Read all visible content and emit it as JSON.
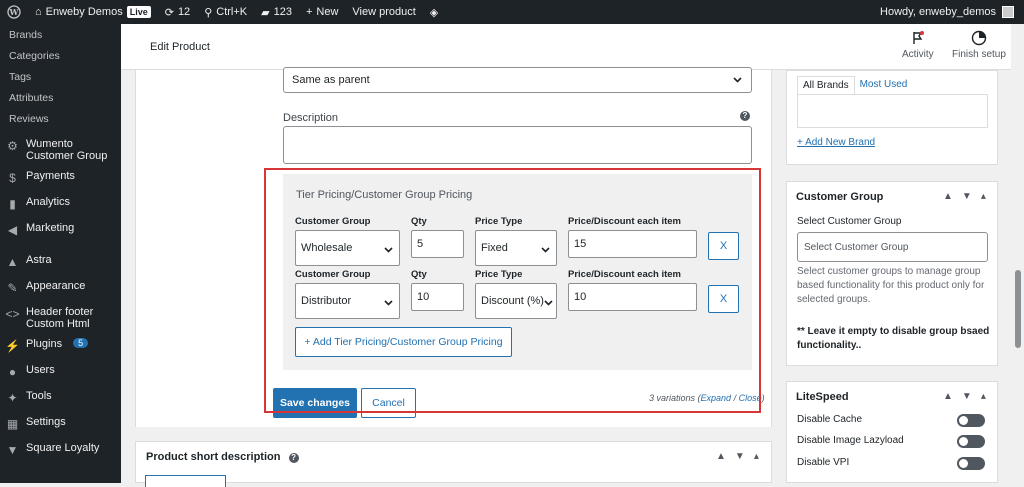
{
  "adminbar": {
    "site_name": "Enweby Demos",
    "live_label": "Live",
    "updates_count": "12",
    "shortcut": "Ctrl+K",
    "comments_count": "123",
    "new_label": "New",
    "view_product": "View product",
    "howdy": "Howdy, enweby_demos"
  },
  "sidebar": {
    "sub_items": [
      "Brands",
      "Categories",
      "Tags",
      "Attributes",
      "Reviews"
    ],
    "menu": {
      "wumento": "Wumento Customer Group",
      "payments": "Payments",
      "analytics": "Analytics",
      "marketing": "Marketing",
      "astra": "Astra",
      "appearance": "Appearance",
      "header_footer": "Header footer Custom Html",
      "plugins": "Plugins",
      "plugins_badge": "5",
      "users": "Users",
      "tools": "Tools",
      "settings": "Settings",
      "square": "Square Loyalty"
    }
  },
  "header": {
    "title": "Edit Product",
    "activity": "Activity",
    "finish_setup": "Finish setup"
  },
  "variation": {
    "shipping_select": "Same as parent",
    "description_label": "Description",
    "tier": {
      "title": "Tier Pricing/Customer Group Pricing",
      "col_group": "Customer Group",
      "col_qty": "Qty",
      "col_price_type": "Price Type",
      "col_discount": "Price/Discount each item",
      "rows": [
        {
          "group": "Wholesale",
          "qty": "5",
          "price_type": "Fixed",
          "discount": "15",
          "remove": "X"
        },
        {
          "group": "Distributor",
          "qty": "10",
          "price_type": "Discount (%)",
          "discount": "10",
          "remove": "X"
        }
      ],
      "add_label": "+ Add Tier Pricing/Customer Group Pricing"
    },
    "save_label": "Save changes",
    "cancel_label": "Cancel",
    "variations_count": "3 variations",
    "expand": "Expand",
    "close": "Close"
  },
  "short_description": {
    "title": "Product short description"
  },
  "brands_box": {
    "tab_all": "All Brands",
    "tab_used": "Most Used",
    "add_link": "+ Add New Brand"
  },
  "customer_group_box": {
    "title": "Customer Group",
    "label": "Select Customer Group",
    "placeholder": "Select Customer Group",
    "help": "Select customer groups to manage group based functionality for this product only for selected groups.",
    "note": "** Leave it empty to disable group bsaed functionality.."
  },
  "litespeed_box": {
    "title": "LiteSpeed",
    "options": [
      "Disable Cache",
      "Disable Image Lazyload",
      "Disable VPI"
    ]
  }
}
